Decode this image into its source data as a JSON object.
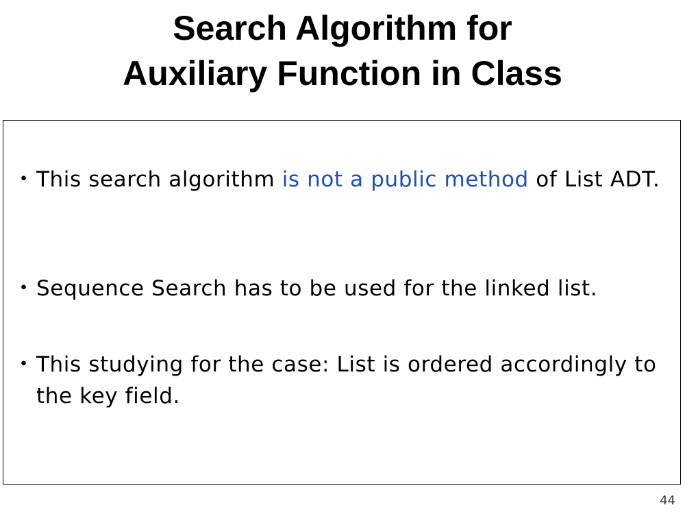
{
  "slide": {
    "title_line1": "Search Algorithm for",
    "title_line2": "Auxiliary Function in Class",
    "bullet_marker": "・",
    "bullets": [
      {
        "before": "This search algorithm ",
        "highlight": "is not a public method",
        "after": " of List ADT."
      },
      {
        "text": "Sequence Search has to be used for the linked list."
      },
      {
        "text": "This studying for the case: List is ordered accordingly to the key field."
      }
    ],
    "page_number": "44",
    "highlight_color": "#1f4fb5"
  }
}
